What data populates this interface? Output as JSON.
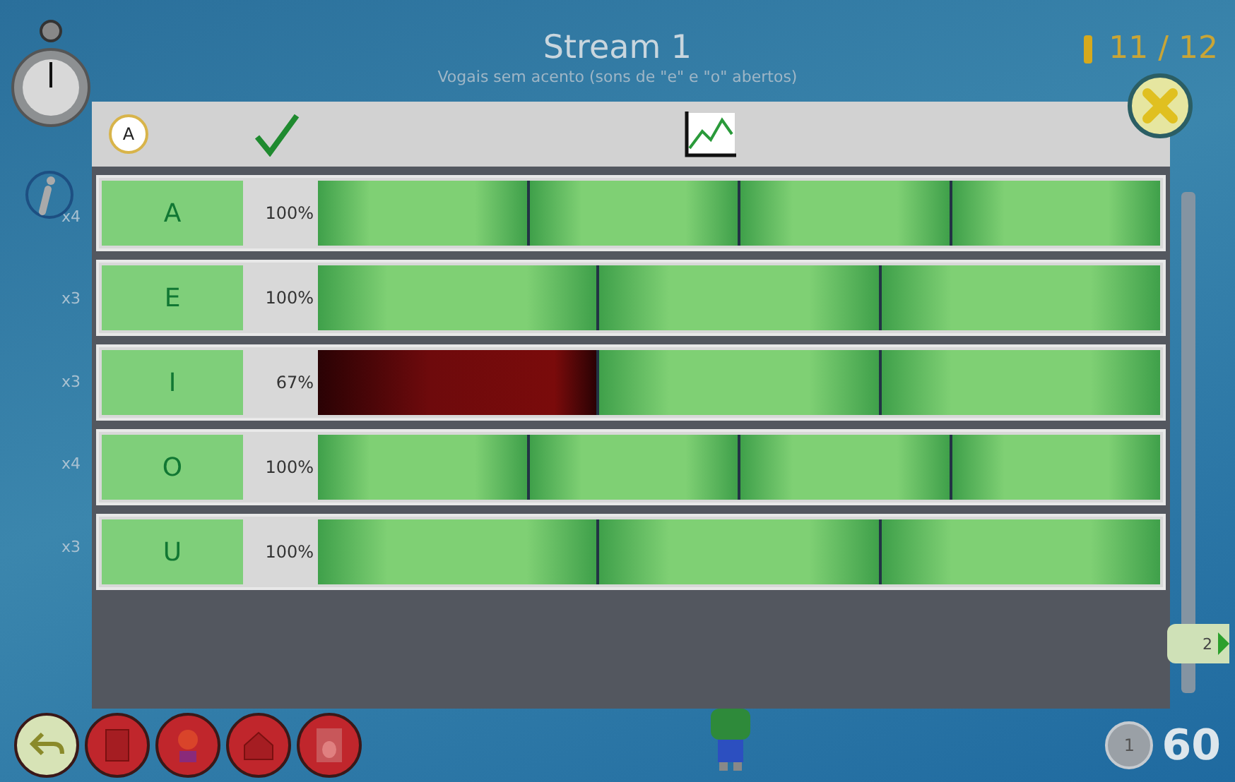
{
  "header": {
    "title": "Stream 1",
    "subtitle": "Vogais sem acento (sons de \"e\" e \"o\" abertos)",
    "progress": "11 / 12"
  },
  "panel": {
    "letter_badge": "A"
  },
  "rows": [
    {
      "multiplier": "x4",
      "letter": "A",
      "percent": "100%",
      "attempts": [
        {
          "correct": true
        },
        {
          "correct": true
        },
        {
          "correct": true
        },
        {
          "correct": true
        }
      ]
    },
    {
      "multiplier": "x3",
      "letter": "E",
      "percent": "100%",
      "attempts": [
        {
          "correct": true
        },
        {
          "correct": true
        },
        {
          "correct": true
        }
      ]
    },
    {
      "multiplier": "x3",
      "letter": "I",
      "percent": "67%",
      "attempts": [
        {
          "correct": false
        },
        {
          "correct": true
        },
        {
          "correct": true
        }
      ]
    },
    {
      "multiplier": "x4",
      "letter": "O",
      "percent": "100%",
      "attempts": [
        {
          "correct": true
        },
        {
          "correct": true
        },
        {
          "correct": true
        },
        {
          "correct": true
        }
      ]
    },
    {
      "multiplier": "x3",
      "letter": "U",
      "percent": "100%",
      "attempts": [
        {
          "correct": true
        },
        {
          "correct": true
        },
        {
          "correct": true
        }
      ]
    }
  ],
  "page_tab": "2",
  "footer": {
    "coin": "1",
    "score": "60"
  }
}
